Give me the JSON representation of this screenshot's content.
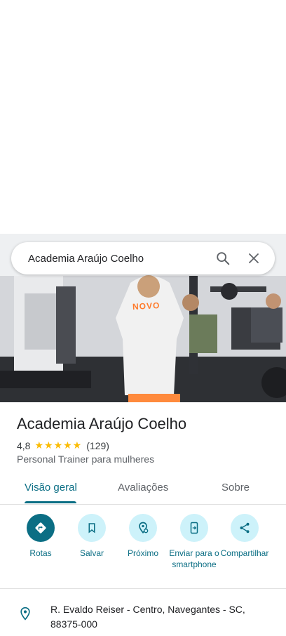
{
  "search": {
    "query": "Academia Araújo Coelho"
  },
  "place": {
    "name": "Academia Araújo Coelho",
    "rating": "4,8",
    "stars": "★★★★★",
    "review_count": "(129)",
    "category": "Personal Trainer para mulheres",
    "shirt_text": "NOVO"
  },
  "tabs": [
    {
      "label": "Visão geral",
      "active": true
    },
    {
      "label": "Avaliações",
      "active": false
    },
    {
      "label": "Sobre",
      "active": false
    }
  ],
  "actions": [
    {
      "label": "Rotas",
      "icon": "directions-icon"
    },
    {
      "label": "Salvar",
      "icon": "bookmark-icon"
    },
    {
      "label": "Próximo",
      "icon": "nearby-icon"
    },
    {
      "label": "Enviar para o smartphone",
      "icon": "send-to-phone-icon"
    },
    {
      "label": "Compartilhar",
      "icon": "share-icon"
    }
  ],
  "address": {
    "text": "R. Evaldo Reiser - Centro, Navegantes - SC, 88375-000"
  },
  "colors": {
    "accent": "#0b6e84",
    "chip_bg": "#cdf2fa",
    "star": "#fbbc04"
  }
}
